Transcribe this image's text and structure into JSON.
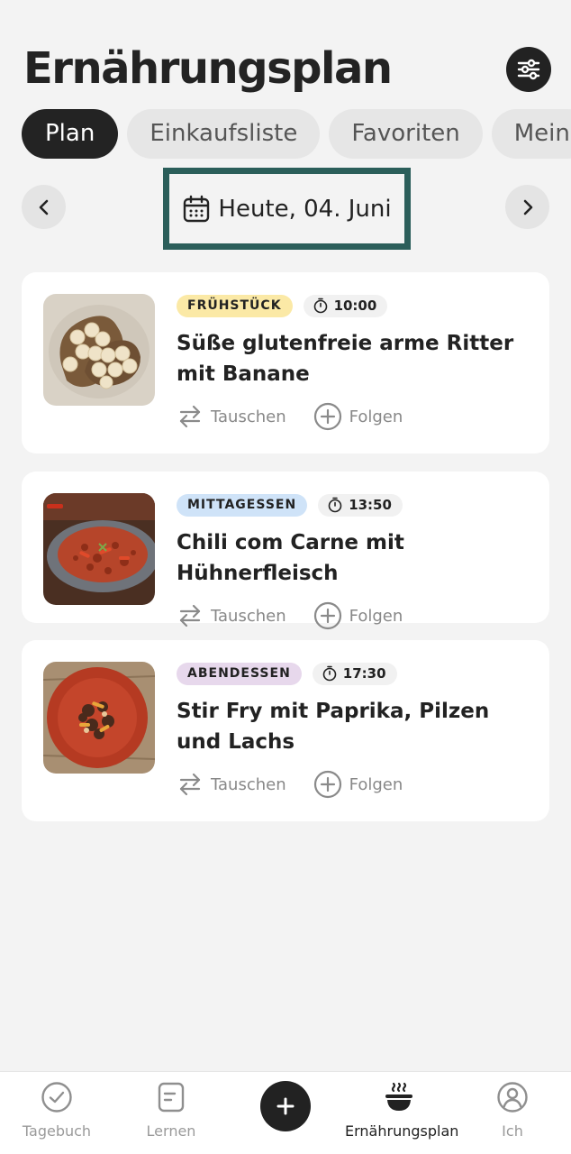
{
  "header": {
    "title": "Ernährungsplan"
  },
  "tabs": [
    {
      "label": "Plan"
    },
    {
      "label": "Einkaufsliste"
    },
    {
      "label": "Favoriten"
    },
    {
      "label": "Mein"
    }
  ],
  "date": {
    "label": "Heute, 04. Juni"
  },
  "meals": [
    {
      "type": "FRÜHSTÜCK",
      "type_color": "#fbe9a6",
      "time": "10:00",
      "name": "Süße glutenfreie arme Ritter mit Banane",
      "swap": "Tauschen",
      "follow": "Folgen"
    },
    {
      "type": "MITTAGESSEN",
      "type_color": "#cfe3f8",
      "time": "13:50",
      "name": "Chili com Carne mit Hühnerfleisch",
      "swap": "Tauschen",
      "follow": "Folgen"
    },
    {
      "type": "ABENDESSEN",
      "type_color": "#e7d8ec",
      "time": "17:30",
      "name": "Stir Fry mit Paprika, Pilzen und Lachs",
      "swap": "Tauschen",
      "follow": "Folgen"
    }
  ],
  "bottom_nav": [
    {
      "label": "Tagebuch",
      "icon": "check-circle-icon"
    },
    {
      "label": "Lernen",
      "icon": "document-icon"
    },
    {
      "label": "",
      "icon": "plus-icon"
    },
    {
      "label": "Ernährungsplan",
      "icon": "bowl-icon"
    },
    {
      "label": "Ich",
      "icon": "profile-icon"
    }
  ]
}
